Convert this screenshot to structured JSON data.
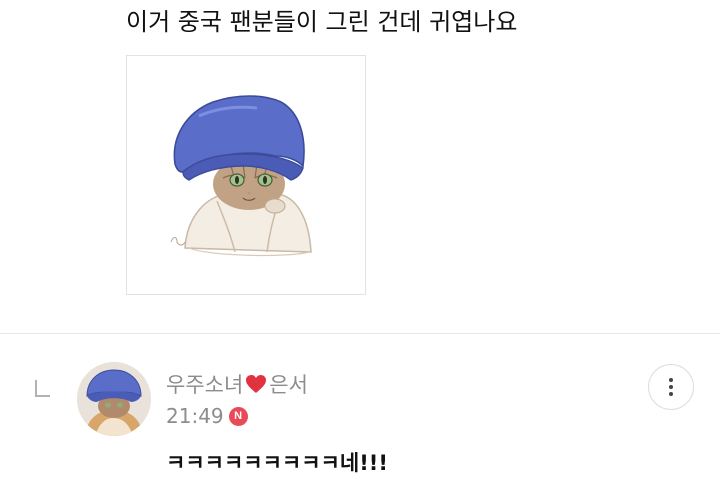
{
  "post": {
    "title": "이거 중국 팬분들이 그린 건데 귀엽나요"
  },
  "comment": {
    "author_name": "우주소녀",
    "author_suffix": "은서",
    "timestamp": "21:49",
    "new_badge": "N",
    "text": "ㅋㅋㅋㅋㅋㅋㅋㅋㅋ네!!!"
  },
  "icons": {
    "reply": "reply-arrow-icon",
    "heart": "heart-icon",
    "more": "more-vertical-icon"
  },
  "colors": {
    "muted_text": "#8c8c8c",
    "new_badge": "#e94a58",
    "heart": "#e0323f",
    "hat": "#5a6dc8"
  }
}
